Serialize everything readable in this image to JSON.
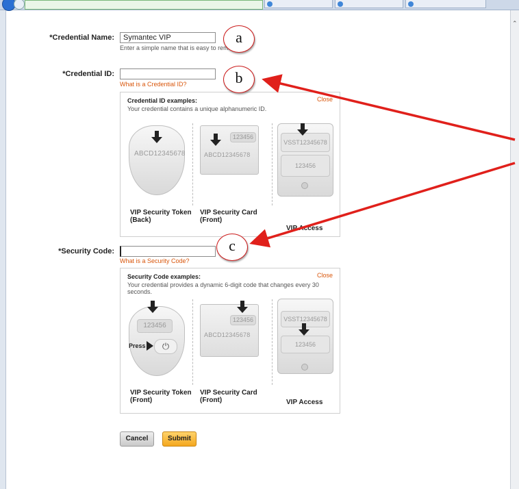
{
  "form": {
    "credential_name_label": "*Credential Name:",
    "credential_name_value": "Symantec VIP",
    "credential_name_hint": "Enter a simple name that is easy to remember.",
    "credential_id_label": "*Credential ID:",
    "credential_id_value": "",
    "credential_id_link": "What is a Credential ID?",
    "security_code_label": "*Security Code:",
    "security_code_value": "",
    "security_code_link": "What is a Security Code?"
  },
  "credential_examples": {
    "title": "Credential ID examples:",
    "description": "Your credential contains a unique alphanumeric ID.",
    "close_label": "Close",
    "token_serial": "ABCD12345678",
    "card_code": "123456",
    "card_serial": "ABCD12345678",
    "access_serial": "VSST12345678",
    "access_code": "123456",
    "captions": {
      "token_line1": "VIP Security Token",
      "token_line2": "(Back)",
      "card_line1": "VIP Security Card",
      "card_line2": "(Front)",
      "access": "VIP Access"
    }
  },
  "code_examples": {
    "title": "Security Code examples:",
    "description": "Your credential provides a dynamic 6-digit code that changes every 30 seconds.",
    "close_label": "Close",
    "token_code": "123456",
    "press_label": "Press",
    "card_code": "123456",
    "card_serial": "ABCD12345678",
    "access_serial": "VSST12345678",
    "access_code": "123456",
    "captions": {
      "token_line1": "VIP Security Token",
      "token_line2": "(Front)",
      "card_line1": "VIP Security Card",
      "card_line2": "(Front)",
      "access": "VIP Access"
    }
  },
  "buttons": {
    "cancel": "Cancel",
    "submit": "Submit"
  },
  "callouts": {
    "a": "a",
    "b": "b",
    "c": "c"
  },
  "colors": {
    "link": "#d9560b",
    "submit": "#f4a71e",
    "annotation": "#e0201b"
  },
  "icons": [
    "power-icon",
    "down-arrow-icon",
    "right-arrow-icon",
    "scroll-up-arrow-icon"
  ]
}
